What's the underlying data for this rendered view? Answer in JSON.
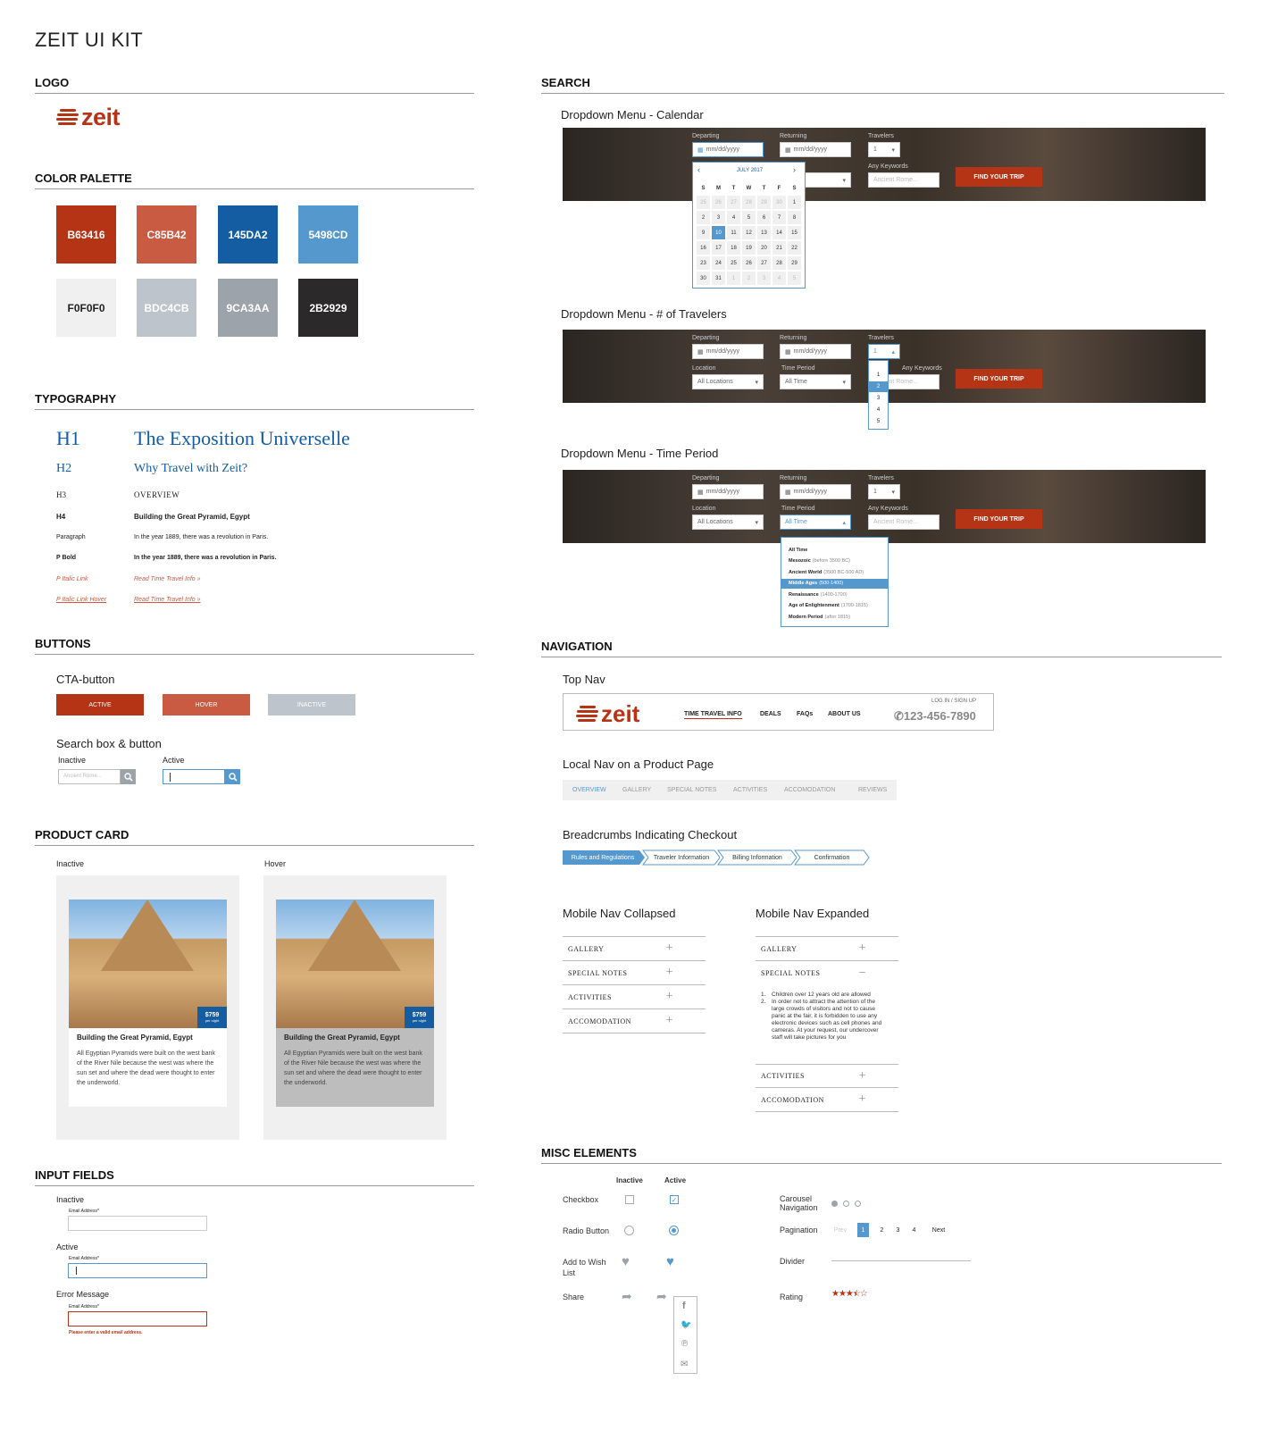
{
  "page_title": "ZEIT UI KIT",
  "sections": {
    "logo": "LOGO",
    "color_palette": "COLOR PALETTE",
    "typography": "TYPOGRAPHY",
    "buttons": "BUTTONS",
    "product_card": "PRODUCT CARD",
    "input_fields": "INPUT FIELDS",
    "search": "SEARCH",
    "navigation": "NAVIGATION",
    "misc": "MISC ELEMENTS"
  },
  "logo_text": "zeit",
  "colors": {
    "primary_red": "#B63416",
    "secondary_red": "#C85B42",
    "blue": "#145DA2",
    "light_blue": "#5498CD",
    "light_gray": "#F0F0F0",
    "gray1": "#BDC4CB",
    "gray2": "#9CA3AA",
    "dark": "#2B2929"
  },
  "palette": [
    "B63416",
    "C85B42",
    "145DA2",
    "5498CD",
    "F0F0F0",
    "BDC4CB",
    "9CA3AA",
    "2B2929"
  ],
  "typography": {
    "h1_label": "H1",
    "h1_sample": "The Exposition Universelle",
    "h2_label": "H2",
    "h2_sample": "Why Travel with Zeit?",
    "h3_label": "H3",
    "h3_sample": "OVERVIEW",
    "h4_label": "H4",
    "h4_sample": "Building the Great Pyramid, Egypt",
    "p_label": "Paragraph",
    "p_sample": "In the year 1889, there was a revolution in Paris.",
    "pb_label": "P Bold",
    "pb_sample": "In the year 1889, there was a revolution in Paris.",
    "pil_label": "P Italic Link",
    "pil_sample": "Read Time Travel Info",
    "pilh_label": "P Italic Link Hover",
    "pilh_sample": "Read Time Travel Info"
  },
  "buttons": {
    "cta_title": "CTA-button",
    "active": "ACTIVE",
    "hover": "HOVER",
    "inactive": "INACTIVE",
    "search_title": "Search box & button",
    "search_inactive_label": "Inactive",
    "search_active_label": "Active",
    "search_placeholder": "Ancient Rome..."
  },
  "product_card": {
    "inactive_label": "Inactive",
    "hover_label": "Hover",
    "price": "$759",
    "price_unit": "per night",
    "title": "Building the Great Pyramid, Egypt",
    "desc": "All Egyptian Pyramids were built on the west bank of the River Nile because the west was where the sun set and where the dead were thought to enter the underworld."
  },
  "input_fields": {
    "inactive_label": "Inactive",
    "active_label": "Active",
    "error_label": "Error Message",
    "field_label": "Email Address*",
    "error_text": "Please enter a valid email address."
  },
  "search": {
    "cal_title": "Dropdown Menu - Calendar",
    "trav_title": "Dropdown Menu - # of Travelers",
    "period_title": "Dropdown Menu - Time Period",
    "departing": "Departing",
    "returning": "Returning",
    "travelers": "Travelers",
    "location": "Location",
    "time_period": "Time Period",
    "keywords": "Any Keywords",
    "date_placeholder": "mm/dd/yyyy",
    "travelers_value": "1",
    "location_value": "All Locations",
    "period_value": "All Time",
    "keywords_placeholder": "Ancient Rome...",
    "find_btn": "FIND YOUR TRIP",
    "cal_month": "JULY 2017",
    "cal_days": [
      "S",
      "M",
      "T",
      "W",
      "T",
      "F",
      "S"
    ],
    "cal_dates": [
      "25",
      "26",
      "27",
      "28",
      "29",
      "30",
      "1",
      "2",
      "3",
      "4",
      "5",
      "6",
      "7",
      "8",
      "9",
      "10",
      "11",
      "12",
      "13",
      "14",
      "15",
      "16",
      "17",
      "18",
      "19",
      "20",
      "21",
      "22",
      "23",
      "24",
      "25",
      "26",
      "27",
      "28",
      "29",
      "30",
      "31",
      "1",
      "2",
      "3",
      "4",
      "5"
    ],
    "traveler_options": [
      "1",
      "2",
      "3",
      "4",
      "5"
    ],
    "period_options": [
      {
        "name": "All Time",
        "range": ""
      },
      {
        "name": "Mesozoic",
        "range": "(before 3500 BC)"
      },
      {
        "name": "Ancient World",
        "range": "(3500 BC-500 AD)"
      },
      {
        "name": "Middle Ages",
        "range": "(500-1400)"
      },
      {
        "name": "Renaissance",
        "range": "(1400-1700)"
      },
      {
        "name": "Age of Enlightenment",
        "range": "(1700-1815)"
      },
      {
        "name": "Modern Period",
        "range": "(after 1815)"
      }
    ]
  },
  "nav": {
    "top_title": "Top Nav",
    "links": [
      "TIME TRAVEL INFO",
      "DEALS",
      "FAQs",
      "ABOUT US"
    ],
    "login": "LOG IN / SIGN UP",
    "phone": "123-456-7890",
    "local_title": "Local Nav on a Product Page",
    "local_tabs": [
      "OVERVIEW",
      "GALLERY",
      "SPECIAL NOTES",
      "ACTIVITIES",
      "ACCOMODATION",
      "REVIEWS"
    ],
    "bc_title": "Breadcrumbs Indicating Checkout",
    "breadcrumbs": [
      "Rules and Regulations",
      "Traveler Information",
      "Billing Information",
      "Confirmation"
    ],
    "mobile_collapsed_title": "Mobile Nav Collapsed",
    "mobile_expanded_title": "Mobile Nav Expanded",
    "mobile_items": [
      "GALLERY",
      "SPECIAL NOTES",
      "ACTIVITIES",
      "ACCOMODATION"
    ],
    "notes_1": "Children over 12 years old are allowed",
    "notes_2": "In order not to attract the attention of the large crowds of visitors and not to cause panic at the fair, it is forbidden to use any electronic devices such as cell phones and cameras. At your request, our undercover staff will take pictures for you"
  },
  "misc": {
    "inactive": "Inactive",
    "active": "Active",
    "checkbox": "Checkbox",
    "radio": "Radio Button",
    "wish_1": "Add to Wish",
    "wish_2": "List",
    "share": "Share",
    "carousel_1": "Carousel",
    "carousel_2": "Navigation",
    "pagination": "Pagination",
    "prev": "Prev",
    "pages": [
      "1",
      "2",
      "3",
      "4"
    ],
    "next": "Next",
    "divider": "Divider",
    "rating": "Rating",
    "rating_value": 3.5
  }
}
